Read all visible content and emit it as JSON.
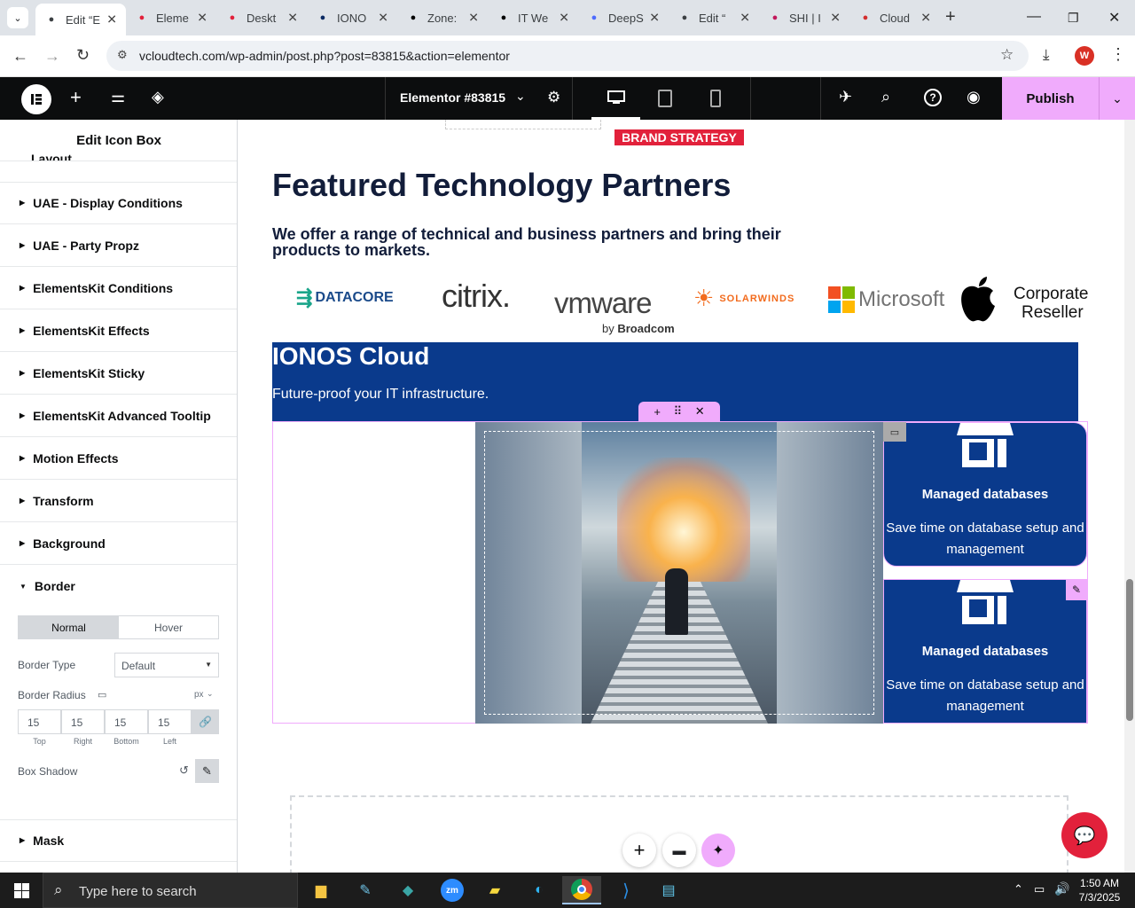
{
  "browser": {
    "tabs": [
      {
        "title": "Edit “E",
        "icon": "wordpress-icon",
        "color": "#3c4043"
      },
      {
        "title": "Eleme",
        "icon": "elementor-red-icon",
        "color": "#e2213b"
      },
      {
        "title": "Deskt",
        "icon": "elementor-red-icon",
        "color": "#e2213b"
      },
      {
        "title": "IONO",
        "icon": "ionos-icon",
        "color": "#0b2a63"
      },
      {
        "title": "Zone:",
        "icon": "zone-icon",
        "color": "#000000"
      },
      {
        "title": "IT We",
        "icon": "chatgpt-icon",
        "color": "#000000"
      },
      {
        "title": "DeepS",
        "icon": "deepseek-icon",
        "color": "#4d6bfe"
      },
      {
        "title": "Edit “",
        "icon": "wordpress-icon",
        "color": "#3c4043"
      },
      {
        "title": "SHI | I",
        "icon": "shi-icon",
        "color": "#c2185b"
      },
      {
        "title": "Cloud",
        "icon": "cloud-icon",
        "color": "#d32f2f"
      }
    ],
    "url": "vcloudtech.com/wp-admin/post.php?post=83815&action=elementor"
  },
  "elementor": {
    "document_title": "Elementor #83815",
    "publish_label": "Publish"
  },
  "sidebar": {
    "title": "Edit Icon Box",
    "partial_section": "Layout",
    "sections": [
      "UAE - Display Conditions",
      "UAE - Party Propz",
      "ElementsKit Conditions",
      "ElementsKit Effects",
      "ElementsKit Sticky",
      "ElementsKit Advanced Tooltip",
      "Motion Effects",
      "Transform",
      "Background"
    ],
    "border": {
      "label": "Border",
      "tab_normal": "Normal",
      "tab_hover": "Hover",
      "border_type_label": "Border Type",
      "border_type_value": "Default",
      "radius_label": "Border Radius",
      "radius_unit": "px",
      "radius_values": [
        "15",
        "15",
        "15",
        "15"
      ],
      "radius_captions": [
        "Top",
        "Right",
        "Bottom",
        "Left"
      ],
      "box_shadow_label": "Box Shadow"
    },
    "mask_label": "Mask"
  },
  "canvas": {
    "badge": "BRAND STRATEGY",
    "heading": "Featured Technology Partners",
    "subheading": "We offer a range of technical and business partners and bring their products to markets.",
    "logos": {
      "datacore": "DATACORE",
      "citrix": "citrix.",
      "vmware": "vmware",
      "vmware_sub_prefix": "by",
      "vmware_sub_brand": "Broadcom",
      "solarwinds": "SOLARWINDS",
      "microsoft": "Microsoft",
      "apple_line1": "Corporate",
      "apple_line2": "Reseller"
    },
    "ionos_title": "IONOS Cloud",
    "ionos_subtitle": "Future-proof your IT infrastructure.",
    "cards": [
      {
        "title": "Managed databases",
        "text": "Save time on database setup and management"
      },
      {
        "title": "Managed databases",
        "text": "Save time on database setup and management"
      }
    ],
    "colors": {
      "navy": "#0a3a8c",
      "badge_red": "#e2213b",
      "accent_pink": "#f0abfc"
    }
  },
  "taskbar": {
    "search_placeholder": "Type here to search",
    "time": "1:50 AM",
    "date": "7/3/2025"
  }
}
